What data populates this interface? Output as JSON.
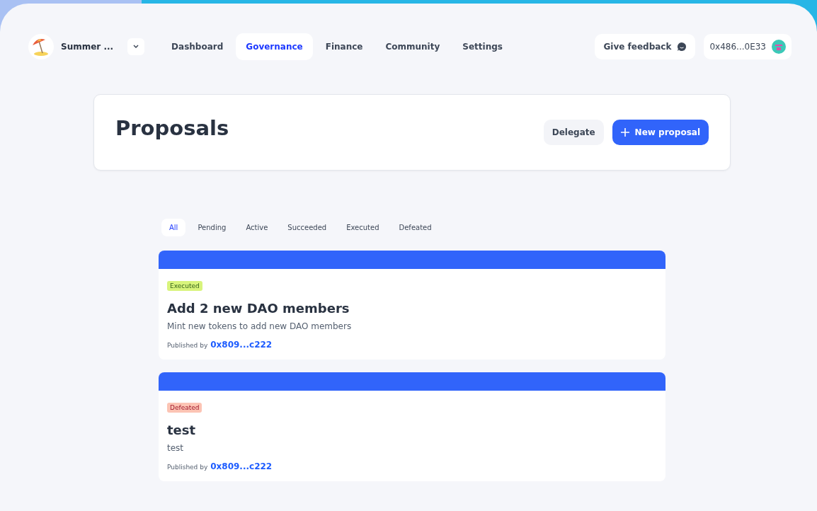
{
  "header": {
    "dao_name": "Summer ...",
    "nav": [
      {
        "label": "Dashboard",
        "selected": false
      },
      {
        "label": "Governance",
        "selected": true
      },
      {
        "label": "Finance",
        "selected": false
      },
      {
        "label": "Community",
        "selected": false
      },
      {
        "label": "Settings",
        "selected": false
      }
    ],
    "feedback": "Give feedback",
    "wallet": "0x486...0E33"
  },
  "page": {
    "title": "Proposals",
    "buttons": [
      {
        "label": "Delegate",
        "kind": "secondary"
      },
      {
        "label": "New proposal",
        "kind": "primary"
      }
    ]
  },
  "filters": [
    {
      "label": "All",
      "selected": true
    },
    {
      "label": "Pending",
      "selected": false
    },
    {
      "label": "Active",
      "selected": false
    },
    {
      "label": "Succeeded",
      "selected": false
    },
    {
      "label": "Executed",
      "selected": false
    },
    {
      "label": "Defeated",
      "selected": false
    }
  ],
  "proposals": [
    {
      "status": "Executed",
      "kind": "executed",
      "title": "Add 2 new DAO members",
      "description": "Mint new tokens to add new DAO members",
      "published_by_label": "Published by",
      "author": "0x809...c222"
    },
    {
      "status": "Defeated",
      "kind": "defeated",
      "title": "test",
      "description": "test",
      "published_by_label": "Published by",
      "author": "0x809...c222"
    }
  ]
}
